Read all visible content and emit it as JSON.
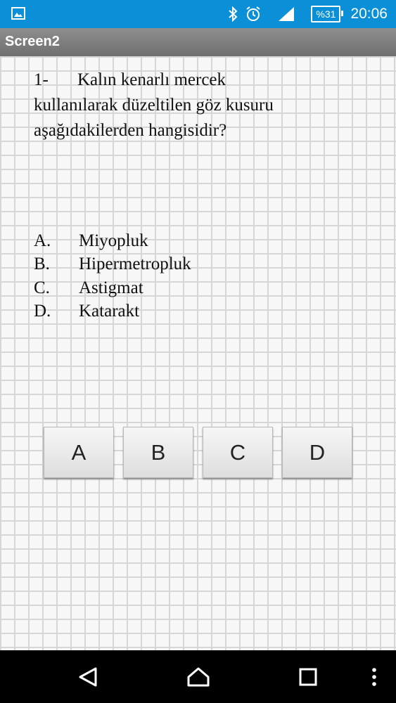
{
  "status_bar": {
    "battery": "%31",
    "time": "20:06",
    "icons": [
      "image-icon",
      "bluetooth-icon",
      "alarm-icon",
      "signal-icon",
      "battery-icon"
    ],
    "color": "#0b8fd6"
  },
  "title_bar": {
    "title": "Screen2"
  },
  "question": {
    "number": "1-",
    "line1": "Kalın kenarlı mercek",
    "line2": "kullanılarak düzeltilen göz kusuru",
    "line3": "aşağıdakilerden hangisidir?"
  },
  "options": [
    {
      "letter": "A.",
      "text": "Miyopluk"
    },
    {
      "letter": "B.",
      "text": "Hipermetropluk"
    },
    {
      "letter": "C.",
      "text": "Astigmat"
    },
    {
      "letter": "D.",
      "text": "Katarakt"
    }
  ],
  "answer_buttons": [
    "A",
    "B",
    "C",
    "D"
  ],
  "nav_bar": {
    "icons": [
      "back-icon",
      "home-icon",
      "recents-icon",
      "menu-icon"
    ]
  }
}
